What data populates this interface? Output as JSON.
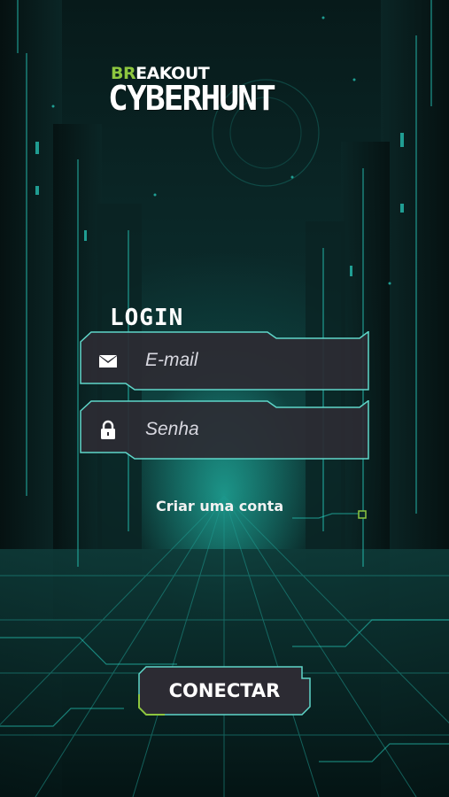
{
  "logo": {
    "prefix_highlight": "BR",
    "prefix_rest": "EAKOUT",
    "name": "CYBERHUNT"
  },
  "login": {
    "title": "LOGIN",
    "email": {
      "placeholder": "E-mail",
      "value": "",
      "icon": "envelope-icon"
    },
    "password": {
      "placeholder": "Senha",
      "value": "",
      "icon": "lock-icon"
    },
    "create_account_label": "Criar uma conta",
    "connect_label": "CONECTAR"
  },
  "colors": {
    "accent": "#8dc63f",
    "neon": "#2ad4c4",
    "field_bg": "#2c2b33",
    "field_border": "#5fd6c9"
  }
}
